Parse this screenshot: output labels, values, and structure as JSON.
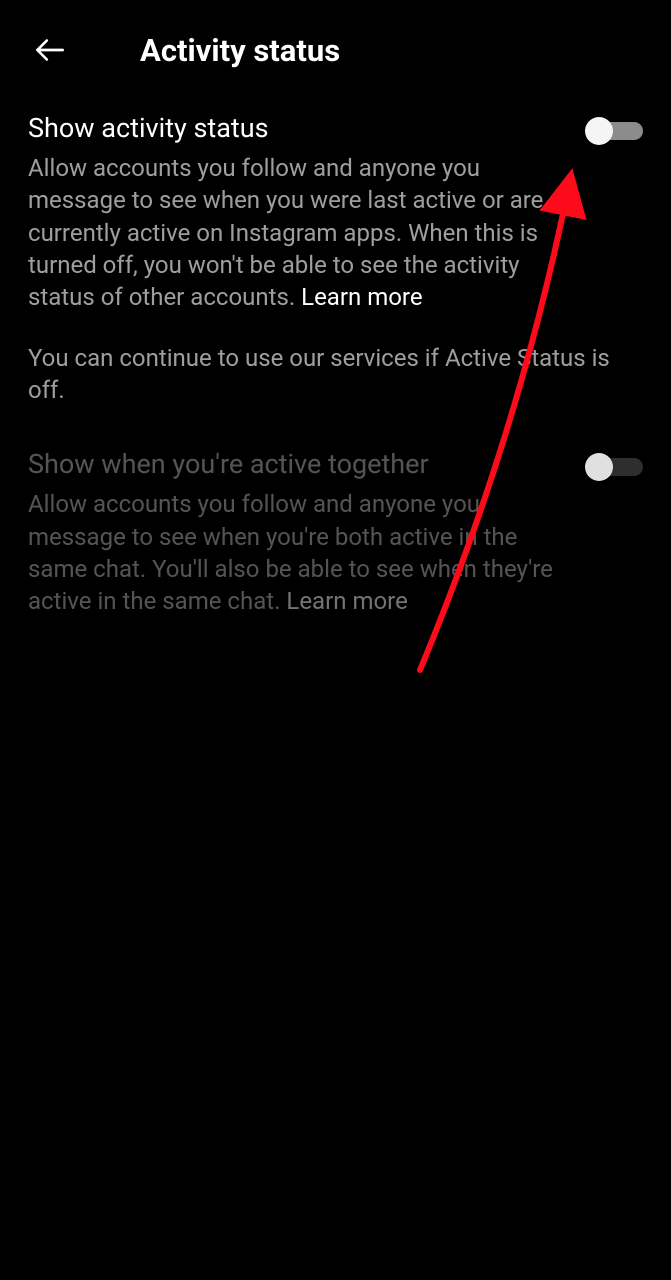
{
  "header": {
    "title": "Activity status"
  },
  "settings": {
    "show_activity": {
      "title": "Show activity status",
      "description": "Allow accounts you follow and anyone you message to see when you were last active or are currently active on Instagram apps. When this is turned off, you won't be able to see the activity status of other accounts. ",
      "learn_more": "Learn more",
      "toggle_on": true
    },
    "note": "You can continue to use our services if Active Status is off.",
    "active_together": {
      "title": "Show when you're active together",
      "description": "Allow accounts you follow and anyone you message to see when you're both active in the same chat. You'll also be able to see when they're active in the same chat. ",
      "learn_more": "Learn more",
      "toggle_on": false,
      "disabled": true
    }
  },
  "annotation": {
    "arrow_color": "#ff0a1a"
  }
}
